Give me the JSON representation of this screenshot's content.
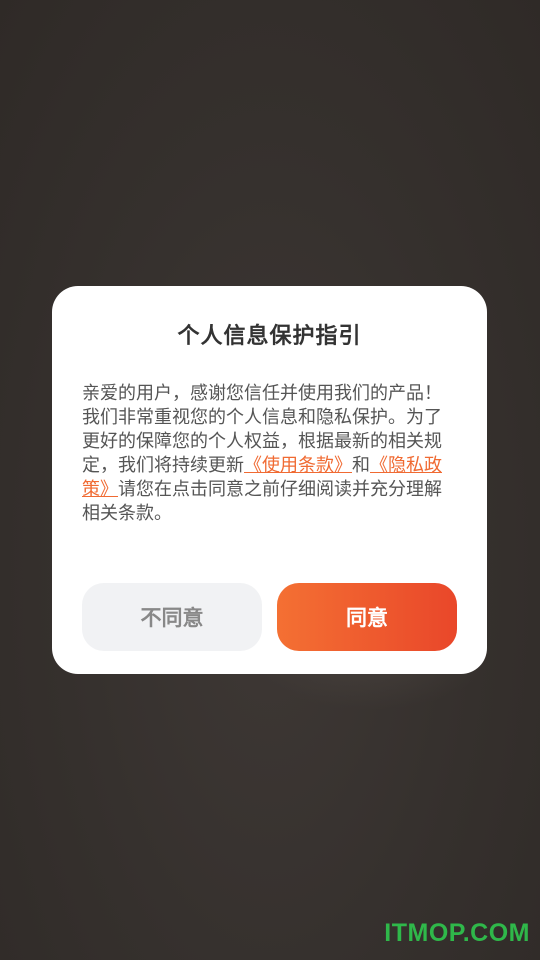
{
  "dialog": {
    "title": "个人信息保护指引",
    "body": {
      "text_before": "亲爱的用户，感谢您信任并使用我们的产品！我们非常重视您的个人信息和隐私保护。为了更好的保障您的个人权益，根据最新的相关规定，我们将持续更新",
      "link_terms": "《使用条款》",
      "connector": "和",
      "link_privacy": "《隐私政策》",
      "text_after": "请您在点击同意之前仔细阅读并充分理解相关条款。"
    },
    "buttons": {
      "disagree_label": "不同意",
      "agree_label": "同意"
    }
  },
  "watermark": "ITMOP.COM",
  "colors": {
    "accent": "#f06a32",
    "agree_gradient_start": "#f47033",
    "agree_gradient_end": "#e9472a",
    "watermark": "#2fb84a"
  }
}
